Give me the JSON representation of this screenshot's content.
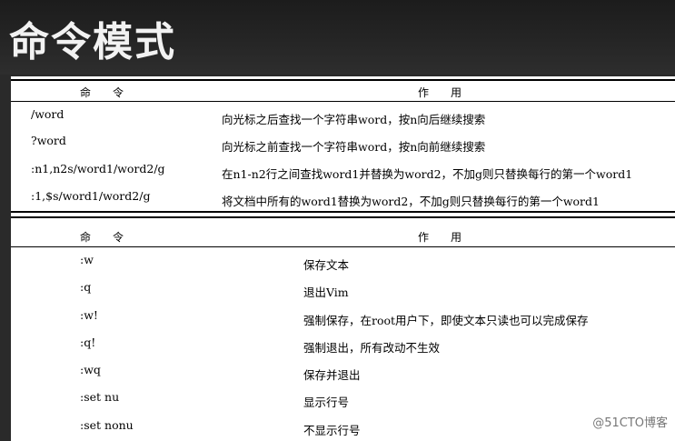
{
  "title": "命令模式",
  "table1": {
    "header_cmd": "命　令",
    "header_func": "作　用",
    "rows": [
      {
        "cmd": "/word",
        "func": "向光标之后查找一个字符串word，按n向后继续搜索"
      },
      {
        "cmd": "?word",
        "func": "向光标之前查找一个字符串word，按n向前继续搜索"
      },
      {
        "cmd": ":n1,n2s/word1/word2/g",
        "func": "在n1-n2行之间查找word1并替换为word2，不加g则只替换每行的第一个word1"
      },
      {
        "cmd": ":1,$s/word1/word2/g",
        "func": "将文档中所有的word1替换为word2，不加g则只替换每行的第一个word1"
      }
    ]
  },
  "table2": {
    "header_cmd": "命　令",
    "header_func": "作　用",
    "rows": [
      {
        "cmd": ":w",
        "func": "保存文本"
      },
      {
        "cmd": ":q",
        "func": "退出Vim"
      },
      {
        "cmd": ":w!",
        "func": "强制保存，在root用户下，即使文本只读也可以完成保存"
      },
      {
        "cmd": ":q!",
        "func": "强制退出，所有改动不生效"
      },
      {
        "cmd": ":wq",
        "func": "保存并退出"
      },
      {
        "cmd": ":set nu",
        "func": "显示行号"
      },
      {
        "cmd": ":set nonu",
        "func": "不显示行号"
      }
    ]
  },
  "watermark": "@51CTO博客"
}
